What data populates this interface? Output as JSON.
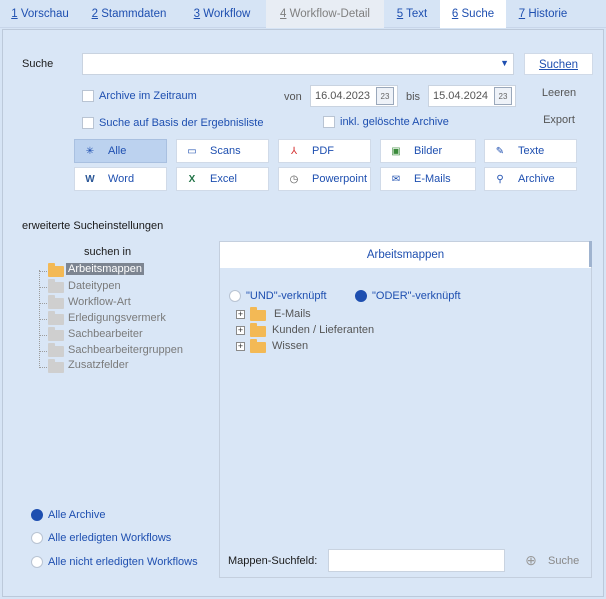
{
  "tabs": [
    {
      "num": "1",
      "label": "Vorschau",
      "state": "normal"
    },
    {
      "num": "2",
      "label": "Stammdaten",
      "state": "normal"
    },
    {
      "num": "3",
      "label": "Workflow",
      "state": "normal"
    },
    {
      "num": "4",
      "label": "Workflow-Detail",
      "state": "disabled"
    },
    {
      "num": "5",
      "label": "Text",
      "state": "normal"
    },
    {
      "num": "6",
      "label": "Suche",
      "state": "active"
    },
    {
      "num": "7",
      "label": "Historie",
      "state": "normal"
    }
  ],
  "search": {
    "label": "Suche",
    "value": "",
    "button": "Suchen",
    "clear": "Leeren",
    "export": "Export"
  },
  "options": {
    "archive_period": "Archive im Zeitraum",
    "result_based": "Suche auf Basis der Ergebnisliste",
    "deleted_archives": "inkl. gelöschte Archive",
    "von": "von",
    "bis": "bis",
    "date_from": "16.04.2023",
    "date_to": "15.04.2024",
    "calendar_icon": "calendar-icon"
  },
  "filters": [
    {
      "label": "Alle",
      "icon": "asterisk-icon",
      "selected": true
    },
    {
      "label": "Scans",
      "icon": "scanner-icon",
      "selected": false
    },
    {
      "label": "PDF",
      "icon": "pdf-icon",
      "selected": false
    },
    {
      "label": "Bilder",
      "icon": "image-icon",
      "selected": false
    },
    {
      "label": "Texte",
      "icon": "text-icon",
      "selected": false
    },
    {
      "label": "Word",
      "icon": "word-icon",
      "selected": false
    },
    {
      "label": "Excel",
      "icon": "excel-icon",
      "selected": false
    },
    {
      "label": "Powerpoint",
      "icon": "powerpoint-icon",
      "selected": false
    },
    {
      "label": "E-Mails",
      "icon": "email-icon",
      "selected": false
    },
    {
      "label": "Archive",
      "icon": "archive-icon",
      "selected": false
    }
  ],
  "advanced": {
    "title": "erweiterte Sucheinstellungen",
    "search_in": "suchen in",
    "tree": [
      "Arbeitsmappen",
      "Dateitypen",
      "Workflow-Art",
      "Erledigungsvermerk",
      "Sachbearbeiter",
      "Sachbearbeitergruppen",
      "Zusatzfelder"
    ],
    "selected_index": 0
  },
  "panel": {
    "title": "Arbeitsmappen",
    "and_label": "\"UND\"-verknüpft",
    "or_label": "\"ODER\"-verknüpft",
    "logic": "or",
    "folders": [
      "E-Mails",
      "Kunden / Lieferanten",
      "Wissen"
    ],
    "search_field_label": "Mappen-Suchfeld:",
    "search_field_value": "",
    "search_button": "Suche",
    "search_icon": "magnifier-icon"
  },
  "scope": {
    "options": [
      "Alle Archive",
      "Alle erledigten Workflows",
      "Alle nicht erledigten Workflows"
    ],
    "selected_index": 0
  },
  "colors": {
    "accent": "#1e4fb0",
    "background": "#d9e6f6",
    "selected_filter": "#bcd2ef",
    "folder": "#f3b955"
  }
}
